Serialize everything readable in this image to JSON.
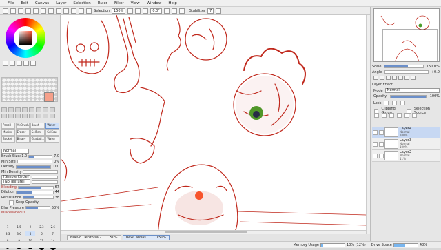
{
  "menu": [
    "File",
    "Edit",
    "Canvas",
    "Layer",
    "Selection",
    "Ruler",
    "Filter",
    "View",
    "Window",
    "Help"
  ],
  "toolbar": {
    "selection_label": "Selection",
    "zoom": "150%",
    "rotation": "0.0°",
    "stabilizer_label": "Stabilizer",
    "stabilizer_value": "7"
  },
  "tools": {
    "brushes": [
      "Pencil",
      "AirBrush",
      "Brush",
      "Water ...",
      "Marker",
      "Eraser",
      "SelPen",
      "SelEras",
      "Bucket",
      "Binary ...",
      "Gradati...",
      "Water ..."
    ],
    "selected_brush_index": 3
  },
  "brush_props": {
    "mode": "Normal",
    "brush_size_label": "Brush Size",
    "brush_size_mult": "x1.0",
    "brush_size_value": "7.0",
    "min_size_label": "Min Size",
    "min_size_value": "0%",
    "density_label": "Density",
    "density_value": "100",
    "min_density_label": "Min Density",
    "shape": "[Simple Circle]",
    "texture": "[No Texture]",
    "blending_label": "Blending",
    "blending_value": "67",
    "dilution_label": "Dilution",
    "dilution_value": "44",
    "persistence_label": "Persistence",
    "persistence_value": "38",
    "keep_opacity_label": "Keep Opacity",
    "blur_pressure_label": "Blur Pressure",
    "blur_pressure_value": "50%",
    "misc_label": "Miscellaneous"
  },
  "brush_sizes": [
    "1",
    "1.5",
    "2",
    "2.3",
    "2.6",
    "3.3",
    "3.6",
    "5",
    "6",
    "7",
    "8",
    "9",
    "10",
    "12",
    "14"
  ],
  "navigator": {
    "scale_label": "Scale",
    "scale_value": "150.0%",
    "angle_label": "Angle",
    "angle_value": "+0.0"
  },
  "layer_effect": {
    "header": "Layer Effect",
    "mode_label": "Mode",
    "mode_value": "Normal",
    "opacity_label": "Opacity",
    "opacity_value": "100%",
    "lock_label": "Lock",
    "clipping_label": "Clipping Group",
    "selection_source_label": "Selection Source"
  },
  "layers": [
    {
      "name": "Layer4",
      "mode": "Normal",
      "opacity": "100%",
      "active": true
    },
    {
      "name": "Layer3",
      "mode": "Normal",
      "opacity": "100%",
      "active": false
    },
    {
      "name": "Layer2",
      "mode": "Normal",
      "opacity": "11%",
      "active": false
    }
  ],
  "tabs": [
    {
      "name": "Nuevo Lienzo.sai2",
      "zoom": "50%"
    },
    {
      "name": "NewCanvas1",
      "zoom": "150%"
    }
  ],
  "status": {
    "memory_label": "Memory Usage",
    "memory_value": "10% (12%)",
    "memory_fraction": 0.1,
    "drive_label": "Drive Space",
    "drive_value": "48%",
    "drive_fraction": 0.48
  },
  "colors": {
    "sketch_red": "#c0281c",
    "eye_green": "#4a9e2a",
    "accent_blue": "#6c8fc9"
  }
}
